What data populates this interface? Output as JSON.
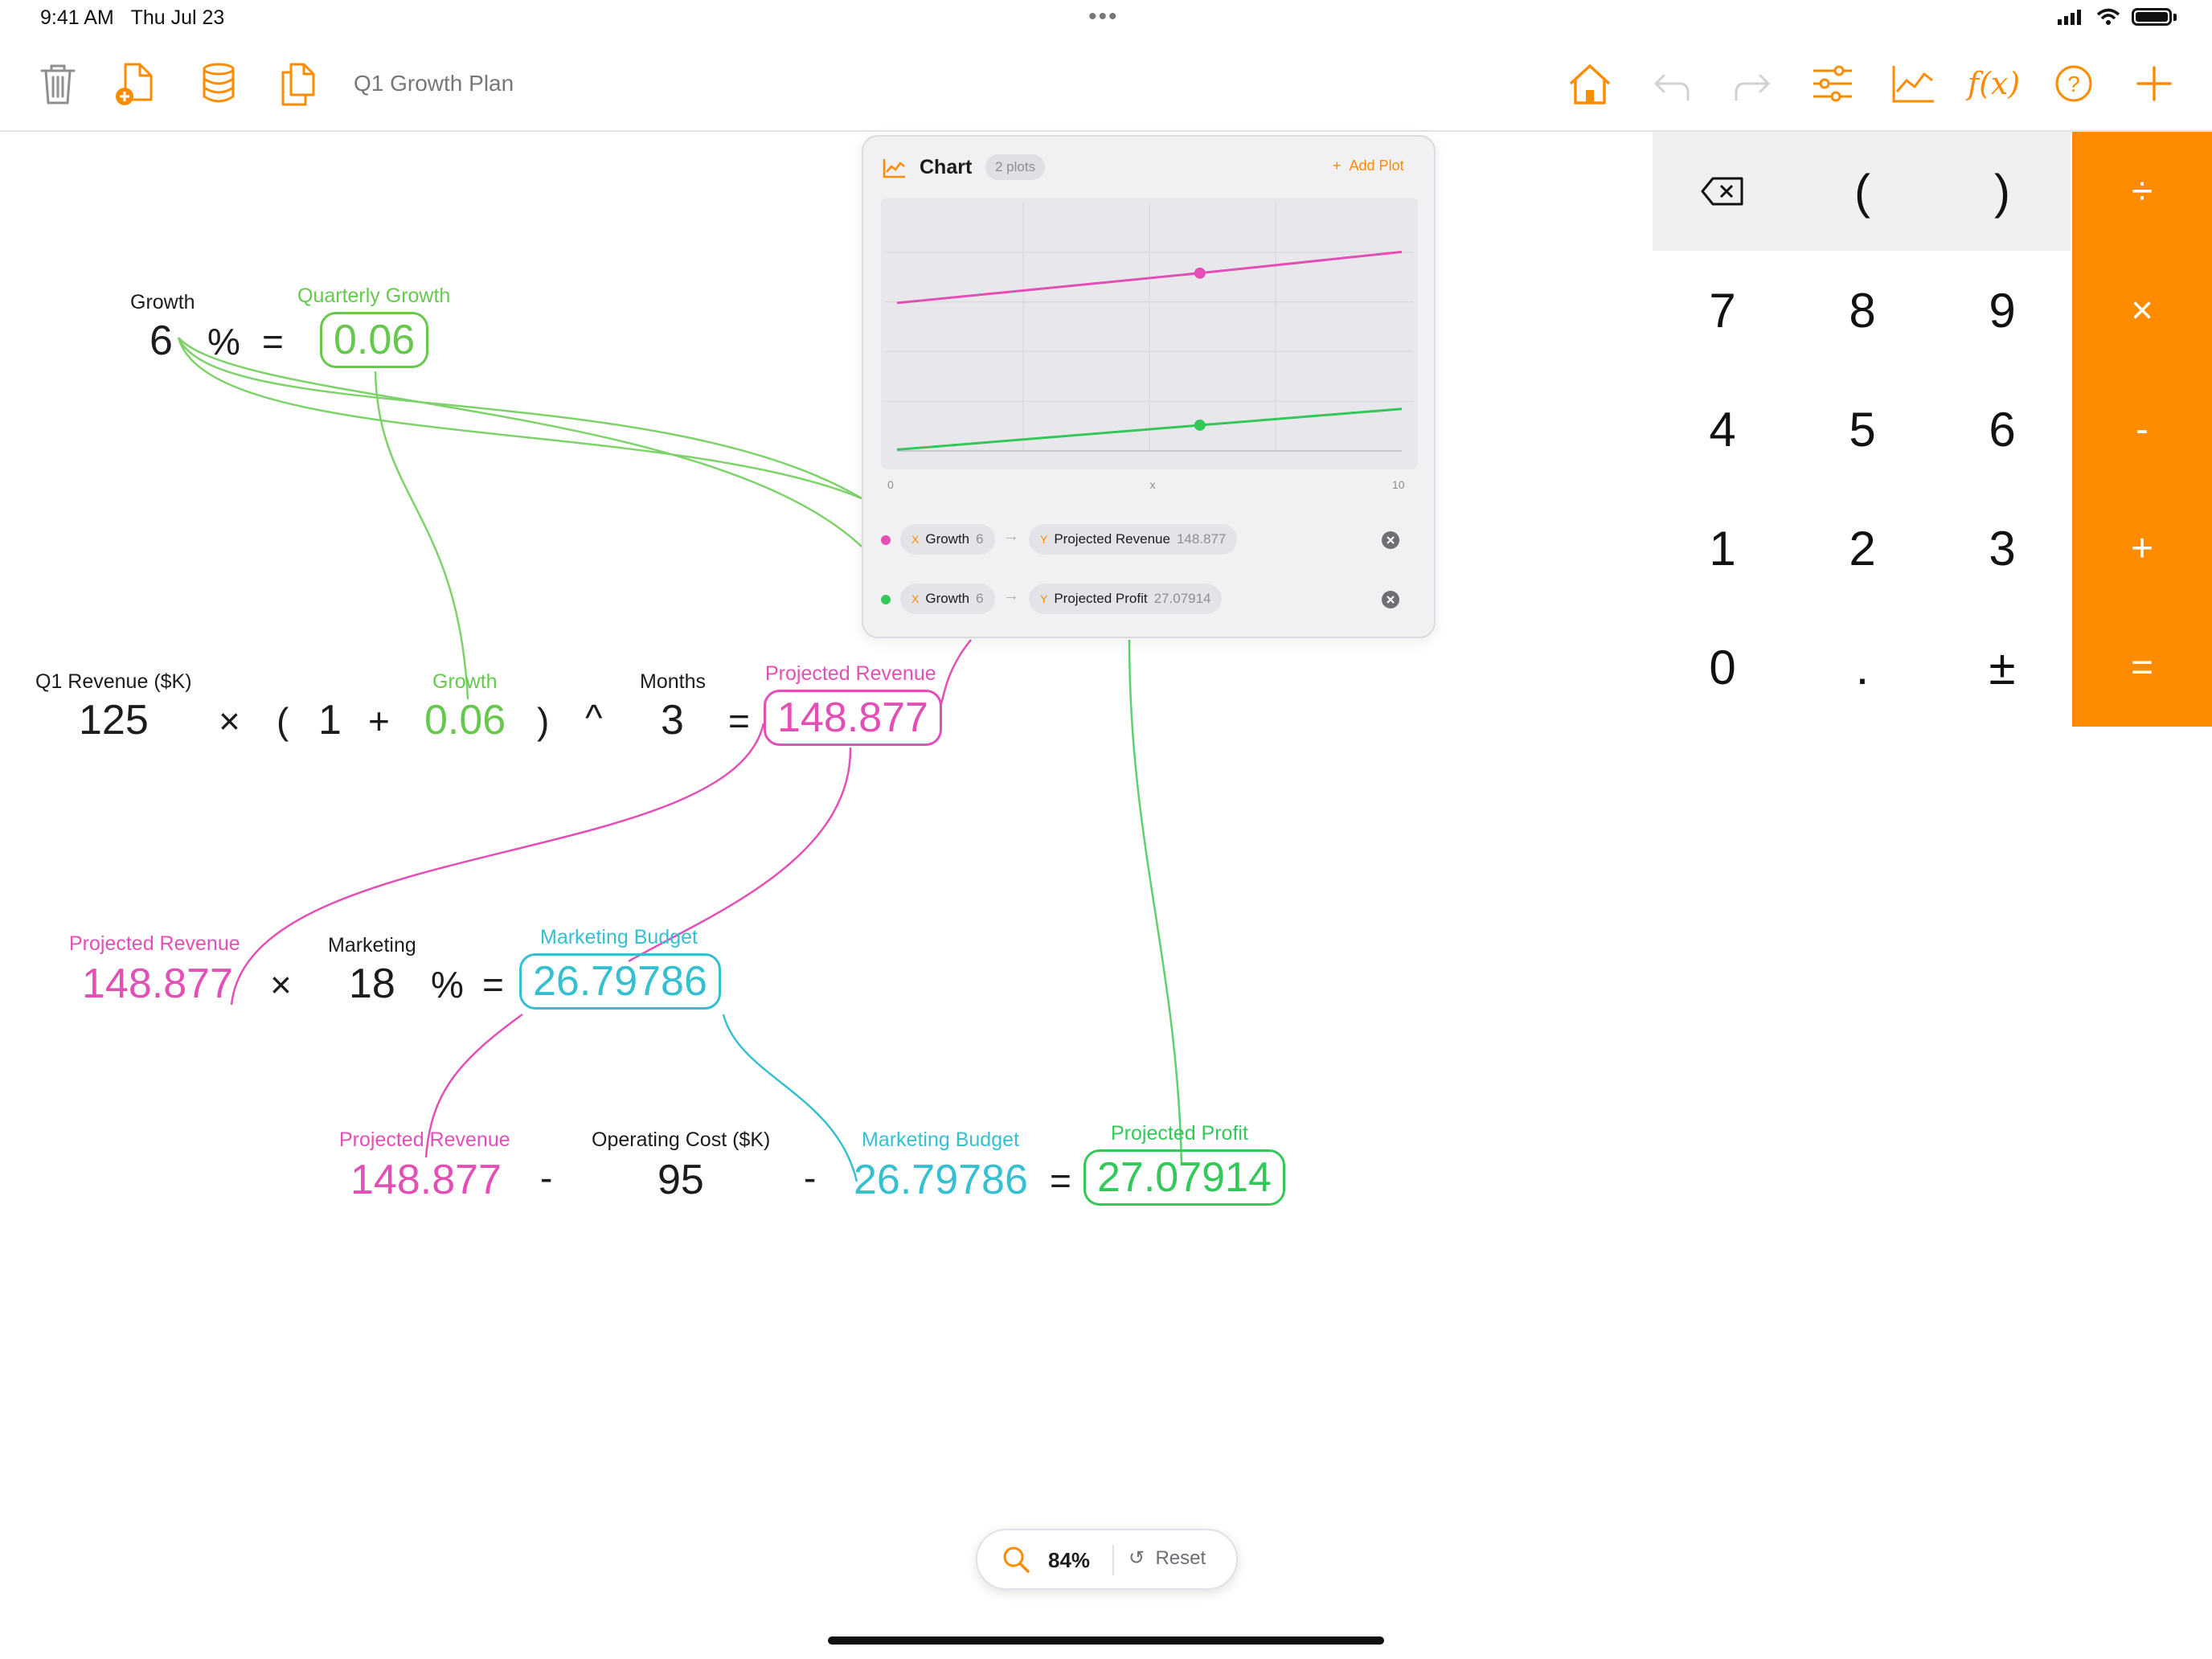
{
  "status_bar": {
    "time": "9:41 AM",
    "date": "Thu Jul 23"
  },
  "toolbar": {
    "title": "Q1 Growth Plan",
    "icons": [
      "trash-icon",
      "new-document-icon",
      "database-icon",
      "duplicate-icon",
      "home-icon",
      "undo-icon",
      "redo-icon",
      "sliders-icon",
      "chart-icon",
      "function-icon",
      "help-icon",
      "add-icon"
    ],
    "function_label": "f(x)",
    "accent": "#ff8c00"
  },
  "eq1": {
    "growth_label": "Growth",
    "growth_value": "6",
    "percent": "%",
    "equals": "=",
    "result_label": "Quarterly Growth",
    "result_value": "0.06"
  },
  "eq2": {
    "revenue_label": "Q1 Revenue ($K)",
    "revenue_value": "125",
    "times": "×",
    "lparen": "(",
    "one": "1",
    "plus": "+",
    "growth_label": "Growth",
    "growth_value": "0.06",
    "rparen": ")",
    "caret": "^",
    "months_label": "Months",
    "months_value": "3",
    "equals": "=",
    "result_label": "Projected Revenue",
    "result_value": "148.877"
  },
  "eq3": {
    "revenue_label": "Projected Revenue",
    "revenue_value": "148.877",
    "times": "×",
    "marketing_label": "Marketing",
    "marketing_value": "18",
    "percent": "%",
    "equals": "=",
    "result_label": "Marketing Budget",
    "result_value": "26.79786"
  },
  "eq4": {
    "revenue_label": "Projected Revenue",
    "revenue_value": "148.877",
    "minus1": "-",
    "cost_label": "Operating Cost ($K)",
    "cost_value": "95",
    "minus2": "-",
    "budget_label": "Marketing Budget",
    "budget_value": "26.79786",
    "equals": "=",
    "result_label": "Projected Profit",
    "result_value": "27.07914"
  },
  "chart_panel": {
    "title": "Chart",
    "badge": "2 plots",
    "add_plot": "Add Plot",
    "plots": [
      {
        "dot_color": "#e24fb6",
        "x_axis": "X",
        "x_name": "Growth",
        "x_value": "6",
        "y_axis": "Y",
        "y_name": "Projected Revenue",
        "y_value": "148.877"
      },
      {
        "dot_color": "#34c759",
        "x_axis": "X",
        "x_name": "Growth",
        "x_value": "6",
        "y_axis": "Y",
        "y_name": "Projected Profit",
        "y_value": "27.07914"
      }
    ]
  },
  "chart_data": {
    "type": "line",
    "xlim": [
      0,
      10
    ],
    "x_tick_labels": [
      "0",
      "10"
    ],
    "xlabel": "x",
    "grid": true,
    "series": [
      {
        "name": "Projected Revenue",
        "color": "#e24fb6",
        "x": [
          0,
          6,
          10
        ],
        "y": [
          125.0,
          148.877,
          165.9
        ],
        "marker_at": 6
      },
      {
        "name": "Projected Profit",
        "color": "#34c759",
        "x": [
          0,
          6,
          10
        ],
        "y": [
          7.5,
          27.07914,
          40.1
        ],
        "marker_at": 6
      }
    ]
  },
  "keypad": {
    "top_row": [
      "⌫",
      "(",
      ")"
    ],
    "rows": [
      [
        "7",
        "8",
        "9"
      ],
      [
        "4",
        "5",
        "6"
      ],
      [
        "1",
        "2",
        "3"
      ],
      [
        "0",
        ".",
        "±"
      ]
    ],
    "operators": [
      "÷",
      "×",
      "-",
      "+",
      "="
    ]
  },
  "zoom": {
    "level": "84%",
    "reset_label": "Reset"
  }
}
